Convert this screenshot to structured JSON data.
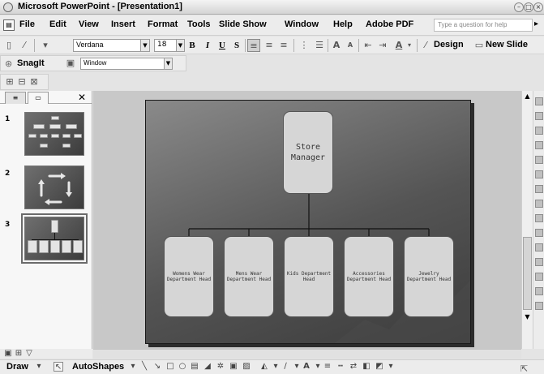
{
  "window": {
    "title": "Microsoft PowerPoint - [Presentation1]"
  },
  "menu": {
    "items": [
      "File",
      "Edit",
      "View",
      "Insert",
      "Format",
      "Tools",
      "Slide Show",
      "Window",
      "Help",
      "Adobe PDF"
    ],
    "help_placeholder": "Type a question for help"
  },
  "formatting": {
    "font": "Verdana",
    "size": "18",
    "bold": "B",
    "italic": "I",
    "underline": "U",
    "shadow": "S",
    "design_label": "Design",
    "new_slide_label": "New Slide"
  },
  "snagit": {
    "label": "SnagIt",
    "profile": "Window"
  },
  "slides": [
    {
      "number": "1"
    },
    {
      "number": "2"
    },
    {
      "number": "3"
    }
  ],
  "org_chart": {
    "top": "Store Manager",
    "children": [
      "Womens Wear Department Head",
      "Mens Wear Department Head",
      "Kids Department Head",
      "Accessories Department Head",
      "Jewelry Department Head"
    ]
  },
  "draw_toolbar": {
    "draw_label": "Draw",
    "autoshapes_label": "AutoShapes"
  }
}
